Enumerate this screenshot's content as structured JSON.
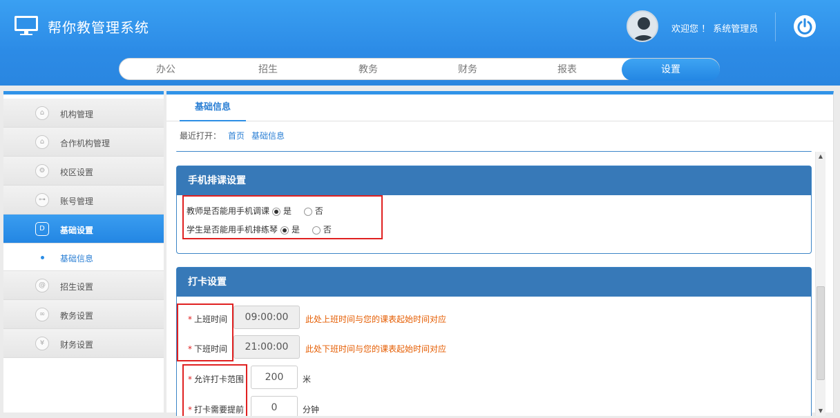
{
  "header": {
    "title": "帮你教管理系统",
    "welcome": "欢迎您 ！ 系统管理员",
    "icons": {
      "logo": "monitor-icon",
      "avatar": "user-avatar",
      "power": "power-icon"
    }
  },
  "nav": {
    "items": [
      "办公",
      "招生",
      "教务",
      "财务",
      "报表",
      "设置"
    ],
    "active": "设置"
  },
  "sidebar": {
    "items": [
      {
        "label": "机构管理",
        "icon": "home-icon"
      },
      {
        "label": "合作机构管理",
        "icon": "home-icon"
      },
      {
        "label": "校区设置",
        "icon": "gear-icon"
      },
      {
        "label": "账号管理",
        "icon": "key-icon"
      },
      {
        "label": "基础设置",
        "icon": "document-icon"
      },
      {
        "label": "基础信息",
        "icon": "dot"
      },
      {
        "label": "招生设置",
        "icon": "paperclip-icon"
      },
      {
        "label": "教务设置",
        "icon": "link-icon"
      },
      {
        "label": "财务设置",
        "icon": "yen-icon"
      }
    ]
  },
  "main": {
    "tab": "基础信息",
    "recent_label": "最近打开：",
    "recent_links": [
      "首页",
      "基础信息"
    ],
    "mobile_panel": {
      "title": "手机排课设置",
      "teacher_question": "教师是否能用手机调课",
      "student_question": "学生是否能用手机排练琴",
      "yes": "是",
      "no": "否",
      "teacher_value": "是",
      "student_value": "是"
    },
    "clock_panel": {
      "title": "打卡设置",
      "star": "*",
      "start_label": "上班时间",
      "start_value": "09:00:00",
      "start_hint": "此处上班时间与您的课表起始时间对应",
      "end_label": "下班时间",
      "end_value": "21:00:00",
      "end_hint": "此处下班时间与您的课表起始时间对应",
      "range_label": "允许打卡范围",
      "range_value": "200",
      "range_unit": "米",
      "advance_label": "打卡需要提前",
      "advance_value": "0",
      "advance_unit": "分钟"
    }
  },
  "colors": {
    "primary": "#2b8de5",
    "panel_head": "#3779b8",
    "highlight": "#e02020",
    "hint": "#e55c00"
  }
}
